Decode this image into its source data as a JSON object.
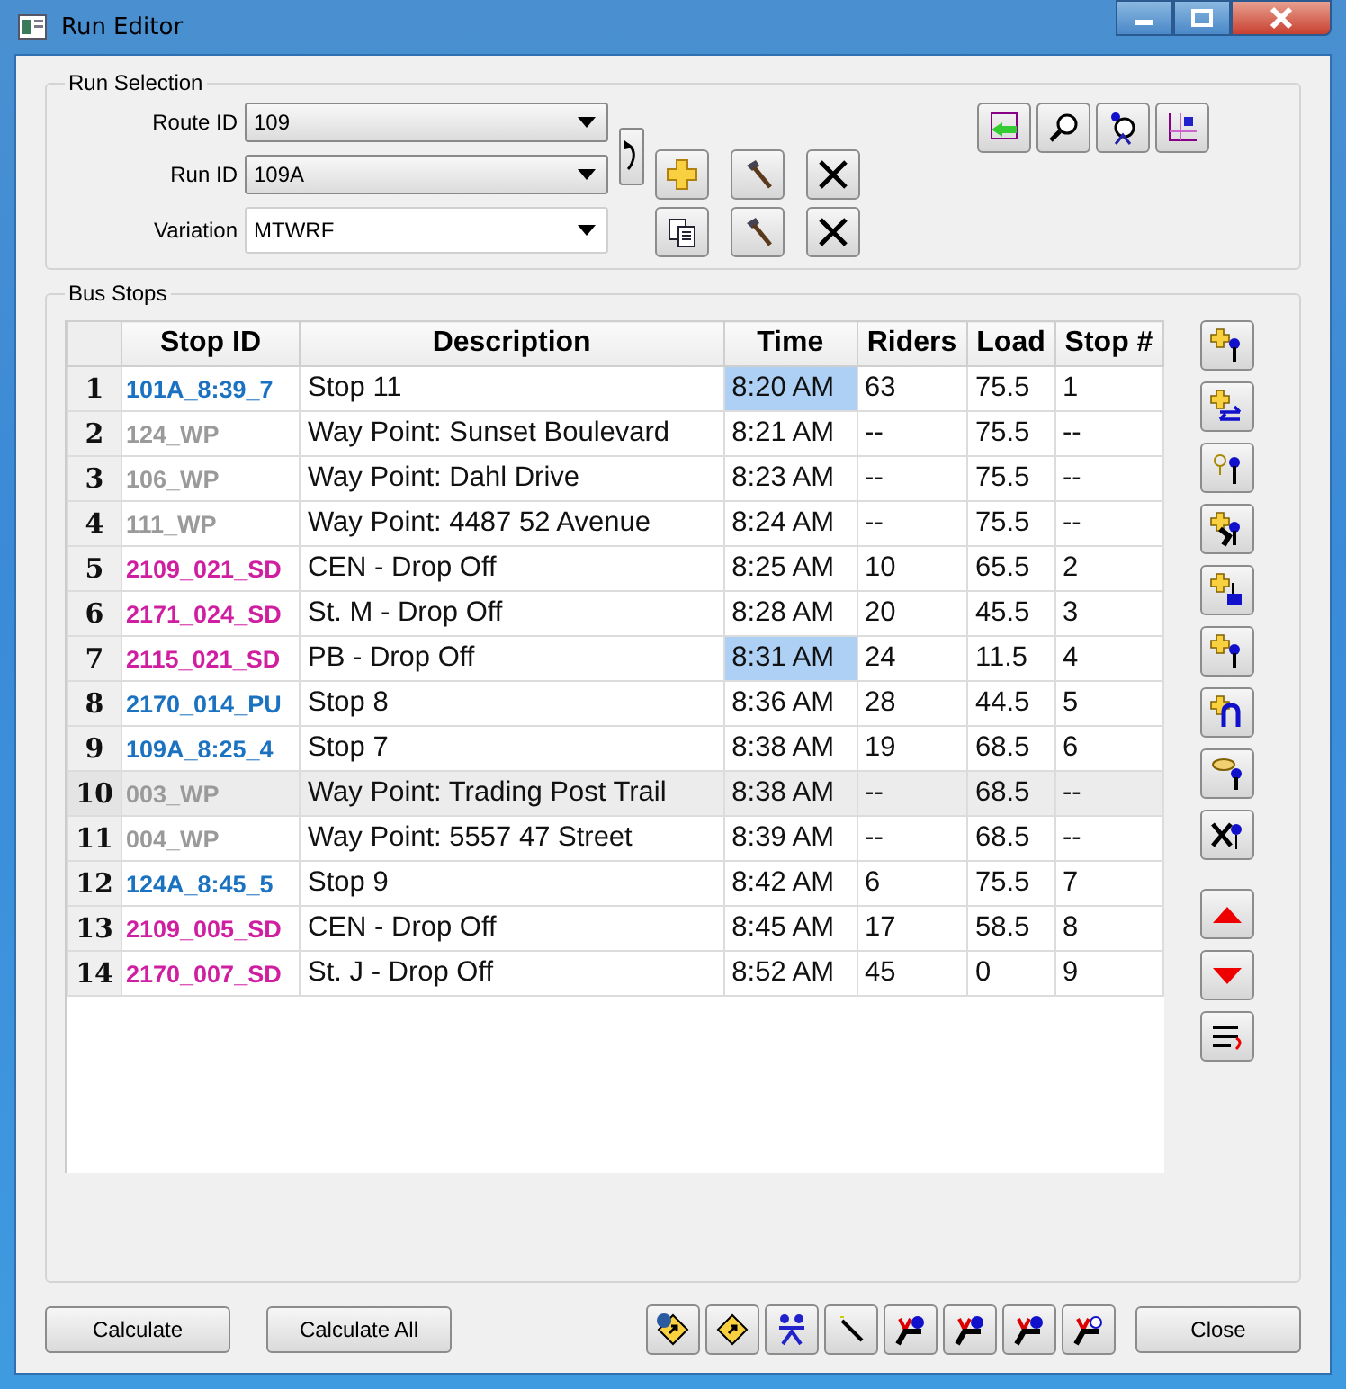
{
  "window": {
    "title": "Run Editor"
  },
  "run_selection": {
    "title": "Run Selection",
    "fields": [
      {
        "label": "Route ID",
        "value": "109",
        "kind": "combo"
      },
      {
        "label": "Run ID",
        "value": "109A",
        "kind": "combo"
      },
      {
        "label": "Variation",
        "value": "MTWRF",
        "kind": "editable"
      }
    ]
  },
  "bus_stops": {
    "title": "Bus Stops",
    "columns": [
      "Stop ID",
      "Description",
      "Time",
      "Riders",
      "Load",
      "Stop #"
    ],
    "rows": [
      {
        "index": "1",
        "stop_id": "101A_8:39_7",
        "color": "#1a72c0",
        "description": "Stop 11",
        "time": "8:20 AM",
        "time_highlighted": true,
        "riders": "63",
        "load": "75.5",
        "stop_no": "1",
        "selected": false
      },
      {
        "index": "2",
        "stop_id": "124_WP",
        "color": "#9a9a9a",
        "description": "Way Point: Sunset Boulevard",
        "time": "8:21 AM",
        "time_highlighted": false,
        "riders": "--",
        "load": "75.5",
        "stop_no": "--",
        "selected": false
      },
      {
        "index": "3",
        "stop_id": "106_WP",
        "color": "#9a9a9a",
        "description": "Way Point: Dahl Drive",
        "time": "8:23 AM",
        "time_highlighted": false,
        "riders": "--",
        "load": "75.5",
        "stop_no": "--",
        "selected": false
      },
      {
        "index": "4",
        "stop_id": "111_WP",
        "color": "#9a9a9a",
        "description": "Way Point: 4487 52 Avenue",
        "time": "8:24 AM",
        "time_highlighted": false,
        "riders": "--",
        "load": "75.5",
        "stop_no": "--",
        "selected": false
      },
      {
        "index": "5",
        "stop_id": "2109_021_SD",
        "color": "#d01ea0",
        "description": "CEN - Drop Off",
        "time": "8:25 AM",
        "time_highlighted": false,
        "riders": "10",
        "load": "65.5",
        "stop_no": "2",
        "selected": false
      },
      {
        "index": "6",
        "stop_id": "2171_024_SD",
        "color": "#d01ea0",
        "description": "St. M - Drop Off",
        "time": "8:28 AM",
        "time_highlighted": false,
        "riders": "20",
        "load": "45.5",
        "stop_no": "3",
        "selected": false
      },
      {
        "index": "7",
        "stop_id": "2115_021_SD",
        "color": "#d01ea0",
        "description": "PB - Drop Off",
        "time": "8:31 AM",
        "time_highlighted": true,
        "riders": "24",
        "load": "11.5",
        "stop_no": "4",
        "selected": false
      },
      {
        "index": "8",
        "stop_id": "2170_014_PU",
        "color": "#1a72c0",
        "description": "Stop 8",
        "time": "8:36 AM",
        "time_highlighted": false,
        "riders": "28",
        "load": "44.5",
        "stop_no": "5",
        "selected": false
      },
      {
        "index": "9",
        "stop_id": "109A_8:25_4",
        "color": "#1a72c0",
        "description": "Stop 7",
        "time": "8:38 AM",
        "time_highlighted": false,
        "riders": "19",
        "load": "68.5",
        "stop_no": "6",
        "selected": false
      },
      {
        "index": "10",
        "stop_id": "003_WP",
        "color": "#9a9a9a",
        "description": "Way Point: Trading Post Trail",
        "time": "8:38 AM",
        "time_highlighted": false,
        "riders": "--",
        "load": "68.5",
        "stop_no": "--",
        "selected": true
      },
      {
        "index": "11",
        "stop_id": "004_WP",
        "color": "#9a9a9a",
        "description": "Way Point: 5557 47 Street",
        "time": "8:39 AM",
        "time_highlighted": false,
        "riders": "--",
        "load": "68.5",
        "stop_no": "--",
        "selected": false
      },
      {
        "index": "12",
        "stop_id": "124A_8:45_5",
        "color": "#1a72c0",
        "description": "Stop 9",
        "time": "8:42 AM",
        "time_highlighted": false,
        "riders": "6",
        "load": "75.5",
        "stop_no": "7",
        "selected": false
      },
      {
        "index": "13",
        "stop_id": "2109_005_SD",
        "color": "#d01ea0",
        "description": "CEN - Drop Off",
        "time": "8:45 AM",
        "time_highlighted": false,
        "riders": "17",
        "load": "58.5",
        "stop_no": "8",
        "selected": false
      },
      {
        "index": "14",
        "stop_id": "2170_007_SD",
        "color": "#d01ea0",
        "description": "St. J - Drop Off",
        "time": "8:52 AM",
        "time_highlighted": false,
        "riders": "45",
        "load": "0",
        "stop_no": "9",
        "selected": false
      }
    ]
  },
  "footer_buttons": [
    "Calculate",
    "Calculate All"
  ],
  "close_button": "Close"
}
